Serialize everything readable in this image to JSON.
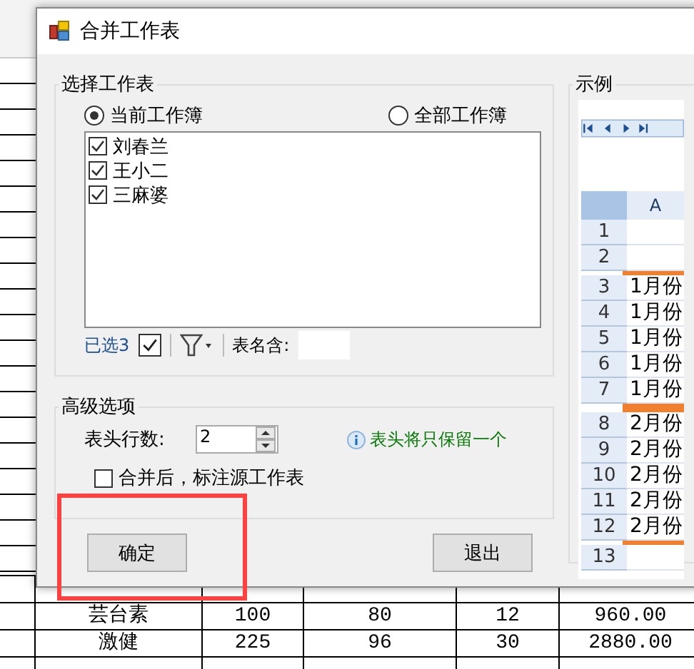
{
  "window": {
    "title": "合并工作表"
  },
  "select_group": {
    "title": "选择工作表",
    "scope": [
      {
        "label": "当前工作簿",
        "selected": true
      },
      {
        "label": "全部工作簿",
        "selected": false
      }
    ],
    "sheets": [
      {
        "name": "刘春兰",
        "checked": true
      },
      {
        "name": "王小二",
        "checked": true
      },
      {
        "name": "三麻婆",
        "checked": true
      }
    ],
    "selected_count": "已选3",
    "select_all_checked": true,
    "name_filter": {
      "label": "表名含:"
    }
  },
  "advanced": {
    "title": "高级选项",
    "header_rows": {
      "label": "表头行数:",
      "value": "2"
    },
    "hint": "表头将只保留一个",
    "mark_source": {
      "label": "合并后，标注源工作表",
      "checked": false
    }
  },
  "buttons": [
    {
      "label": "确定"
    },
    {
      "label": "退出"
    }
  ],
  "example": {
    "title": "示例",
    "column": "A",
    "rows_before": [
      "1",
      "2"
    ],
    "blocks": [
      {
        "rows": [
          {
            "number": "3",
            "cell": "1月份"
          },
          {
            "number": "4",
            "cell": "1月份"
          },
          {
            "number": "5",
            "cell": "1月份"
          },
          {
            "number": "6",
            "cell": "1月份"
          },
          {
            "number": "7",
            "cell": "1月份"
          }
        ]
      },
      {
        "rows": [
          {
            "number": "8",
            "cell": "2月份"
          },
          {
            "number": "9",
            "cell": "2月份"
          },
          {
            "number": "10",
            "cell": "2月份"
          },
          {
            "number": "11",
            "cell": "2月份"
          },
          {
            "number": "12",
            "cell": "2月份"
          }
        ]
      }
    ],
    "rows_after": [
      "13"
    ]
  },
  "background_sheet": {
    "rows": [
      {
        "cells": [
          "芸台素",
          "100",
          "80",
          "12",
          "960.00"
        ]
      },
      {
        "cells": [
          "激健",
          "225",
          "96",
          "30",
          "2880.00"
        ]
      }
    ]
  }
}
